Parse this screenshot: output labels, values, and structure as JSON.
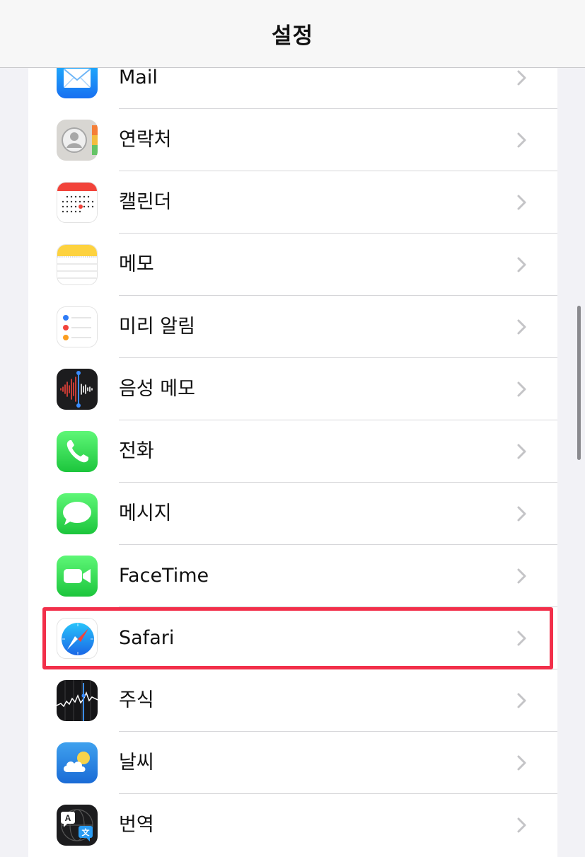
{
  "header": {
    "title": "설정"
  },
  "settings_list": {
    "items": [
      {
        "label": "Mail",
        "icon": "mail-icon"
      },
      {
        "label": "연락처",
        "icon": "contacts-icon"
      },
      {
        "label": "캘린더",
        "icon": "calendar-icon"
      },
      {
        "label": "메모",
        "icon": "notes-icon"
      },
      {
        "label": "미리 알림",
        "icon": "reminders-icon"
      },
      {
        "label": "음성 메모",
        "icon": "voice-memos-icon"
      },
      {
        "label": "전화",
        "icon": "phone-icon"
      },
      {
        "label": "메시지",
        "icon": "messages-icon"
      },
      {
        "label": "FaceTime",
        "icon": "facetime-icon"
      },
      {
        "label": "Safari",
        "icon": "safari-icon",
        "highlighted": true
      },
      {
        "label": "주식",
        "icon": "stocks-icon"
      },
      {
        "label": "날씨",
        "icon": "weather-icon"
      },
      {
        "label": "번역",
        "icon": "translate-icon"
      }
    ]
  },
  "colors": {
    "highlight_border": "#f22f4a",
    "background": "#f2f2f6",
    "row_background": "#ffffff",
    "chevron": "#c4c4c7"
  }
}
